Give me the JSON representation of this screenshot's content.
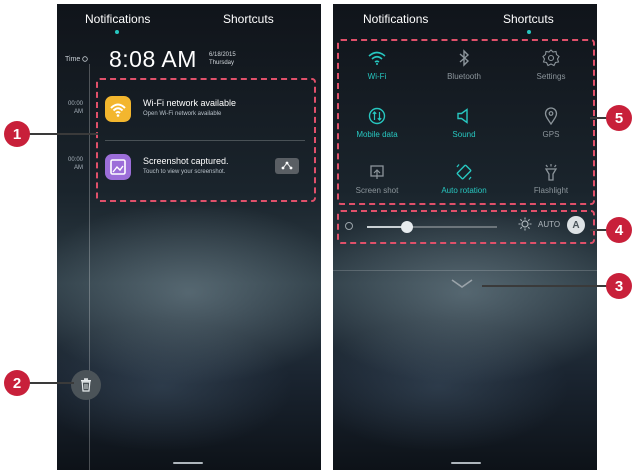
{
  "left_screen": {
    "tabs": {
      "notifications": "Notifications",
      "shortcuts": "Shortcuts",
      "active": "notifications"
    },
    "time_label": "Time",
    "clock": "8:08 AM",
    "date": "6/18/2015",
    "weekday": "Thursday",
    "notifications": [
      {
        "time": "00:00",
        "ampm": "AM",
        "title": "Wi-Fi network available",
        "subtitle": "Open Wi-Fi network available",
        "icon": "wifi-icon"
      },
      {
        "time": "00:00",
        "ampm": "AM",
        "title": "Screenshot captured.",
        "subtitle": "Touch to view your screenshot.",
        "icon": "screenshot-icon",
        "action_icon": "share-icon"
      }
    ],
    "clear_icon": "trash-icon"
  },
  "right_screen": {
    "tabs": {
      "notifications": "Notifications",
      "shortcuts": "Shortcuts",
      "active": "shortcuts"
    },
    "toggles": [
      {
        "label": "Wi-Fi",
        "icon": "wifi-icon",
        "active": true
      },
      {
        "label": "Bluetooth",
        "icon": "bluetooth-icon",
        "active": false
      },
      {
        "label": "Settings",
        "icon": "gear-icon",
        "active": false
      },
      {
        "label": "Mobile data",
        "icon": "mobile-data-icon",
        "active": true
      },
      {
        "label": "Sound",
        "icon": "speaker-icon",
        "active": true
      },
      {
        "label": "GPS",
        "icon": "location-pin-icon",
        "active": false
      },
      {
        "label": "Screen shot",
        "icon": "screenshot-icon",
        "active": false
      },
      {
        "label": "Auto rotation",
        "icon": "rotation-icon",
        "active": true
      },
      {
        "label": "Flashlight",
        "icon": "flashlight-icon",
        "active": false
      }
    ],
    "brightness": {
      "level": 0.31,
      "auto_label": "AUTO",
      "auto_badge": "A"
    },
    "expand_icon": "chevron-down-icon"
  },
  "callouts": [
    "1",
    "2",
    "3",
    "4",
    "5"
  ],
  "colors": {
    "accent": "#27c7c0",
    "callout": "#c8203a",
    "highlight_border": "#e0506a",
    "wifi_app": "#f3b62e",
    "screenshot_app": "#9c6ed9"
  }
}
